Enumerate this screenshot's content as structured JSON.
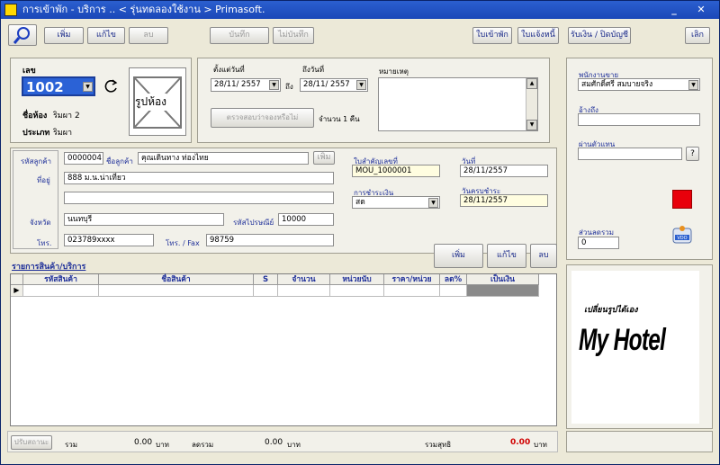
{
  "window": {
    "title": "การเข้าพัก - บริการ .. < รุ่นทดลองใช้งาน > Primasoft.",
    "minimize": "_",
    "close": "✕"
  },
  "toolbar": {
    "add": "เพิ่ม",
    "edit": "แก้ไข",
    "delete": "ลบ",
    "save": "บันทึก",
    "cancel": "ไม่บันทึก",
    "checkin_slip": "ใบเข้าพัก",
    "notify_slip": "ใบแจ้งหนี้",
    "receive_close": "รับเงิน / ปิดบัญชี",
    "exit": "เลิก"
  },
  "room": {
    "no_label": "เลข",
    "no": "1002",
    "name_label": "ชื่อห้อง",
    "name": "ริมผา 2",
    "type_label": "ประเภท",
    "type": "ริมผา",
    "photo": "รูปห้อง"
  },
  "dates": {
    "from_label": "ตั้งแต่วันที่",
    "from": "28/11/ 2557",
    "to_word": "ถึง",
    "to_label": "ถึงวันที่",
    "to": "28/11/ 2557",
    "check_btn": "ตรวจสอบว่าจองหรือไม่",
    "count": "จำนวน 1 คืน",
    "note_label": "หมายเหตุ"
  },
  "customer": {
    "code_label": "รหัสลูกค้า",
    "code": "0000004",
    "name_label": "ชื่อลูกค้า",
    "name": "คุณเดินทาง ท่องไทย",
    "add": "เพิ่ม",
    "addr_label": "ที่อยู่",
    "addr1": "888 ม.น.น่าเที่ยว",
    "addr2": "",
    "prov_label": "จังหวัด",
    "prov": "นนทบุรี",
    "zip_label": "รหัสไปรษณีย์",
    "zip": "10000",
    "tel_label": "โทร.",
    "tel": "023789xxxx",
    "fax_label": "โทร. / Fax",
    "fax": "98759"
  },
  "doc": {
    "no_label": "ใบสำคัญเลขที่",
    "no": "MOU_1000001",
    "date_label": "วันที่",
    "date": "28/11/2557",
    "pay_label": "การชำระเงิน",
    "pay": "สด",
    "due_label": "วันครบชำระ",
    "due": "28/11/2557"
  },
  "items": {
    "title": "รายการสินค้า/บริการ",
    "add": "เพิ่ม",
    "edit": "แก้ไข",
    "delete": "ลบ",
    "columns": [
      "รหัสสินค้า",
      "ชื่อสินค้า",
      "S",
      "จำนวน",
      "หน่วยนับ",
      "ราคา/หน่วย",
      "ลด%",
      "เป็นเงิน"
    ]
  },
  "right": {
    "sales_label": "พนักงานขาย",
    "sales": "สมศักดิ์ศรี สมบายจริง",
    "ref_label": "อ้างถึง",
    "ref": "",
    "rep_label": "ผ่านตัวแทน",
    "rep": "",
    "rep_btn": "?",
    "disc_label": "ส่วนลดรวม",
    "disc": "0",
    "status_color": "#e8000b",
    "logo_small": "เปลี่ยนรูปได้เอง",
    "logo_big": "My Hotel"
  },
  "status": {
    "adjust": "ปรับสถานะ",
    "sum_label": "รวม",
    "sum": "0.00",
    "sum_unit": "บาท",
    "disc_label": "ลดรวม",
    "disc": "0.00",
    "disc_unit": "บาท",
    "net_label": "รวมสุทธิ",
    "net": "0.00",
    "net_unit": "บาท"
  }
}
